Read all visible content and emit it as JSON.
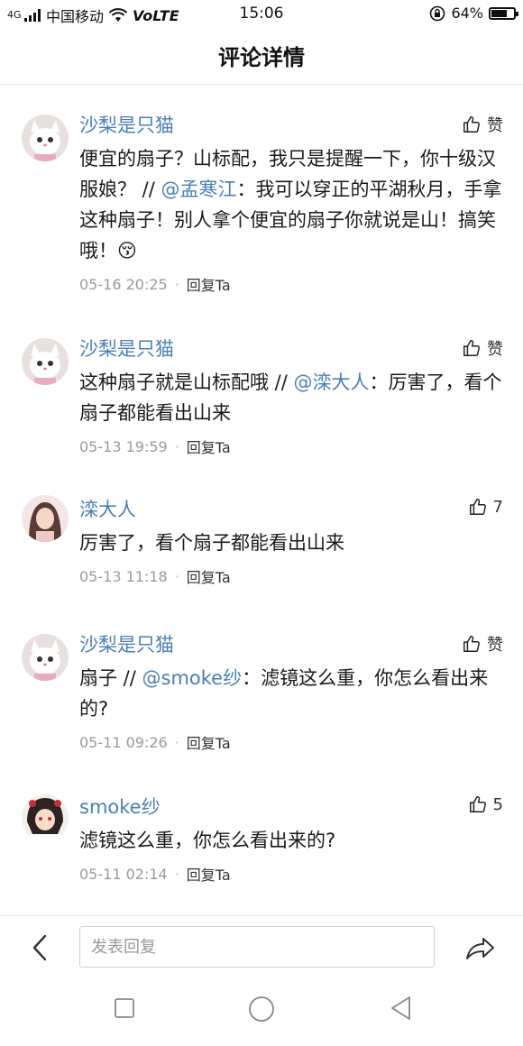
{
  "status_bar": {
    "carrier": "中国移动",
    "network": "VoLTE",
    "signal_prefix": "4G",
    "time": "15:06",
    "battery": "64%",
    "battery_level": 0.64
  },
  "header": {
    "title": "评论详情"
  },
  "comments": [
    {
      "username": "沙梨是只猫",
      "like_label": "赞",
      "text_before": "便宜的扇子？山标配，我只是提醒一下，你十级汉服娘？ // ",
      "mention": "@孟寒江",
      "text_after": "：我可以穿正的平湖秋月，手拿这种扇子！别人拿个便宜的扇子你就说是山！搞笑哦！",
      "emoji": "😚",
      "time": "05-16 20:25",
      "reply": "回复Ta"
    },
    {
      "username": "沙梨是只猫",
      "like_label": "赞",
      "text_before": "这种扇子就是山标配哦 // ",
      "mention": "@滦大人",
      "text_after": "：厉害了，看个扇子都能看出山来",
      "time": "05-13 19:59",
      "reply": "回复Ta"
    },
    {
      "username": "滦大人",
      "like_label": "7",
      "text_before": "厉害了，看个扇子都能看出山来",
      "time": "05-13 11:18",
      "reply": "回复Ta"
    },
    {
      "username": "沙梨是只猫",
      "like_label": "赞",
      "text_before": "扇子 // ",
      "mention": "@smoke纱",
      "text_after": "：滤镜这么重，你怎么看出来的?",
      "time": "05-11 09:26",
      "reply": "回复Ta"
    },
    {
      "username": "smoke纱",
      "like_label": "5",
      "text_before": "滤镜这么重，你怎么看出来的?",
      "time": "05-11 02:14",
      "reply": "回复Ta"
    }
  ],
  "bottom_bar": {
    "input_placeholder": "发表回复"
  },
  "colors": {
    "accent": "#4a7fb5",
    "meta": "#9a9a9a"
  }
}
